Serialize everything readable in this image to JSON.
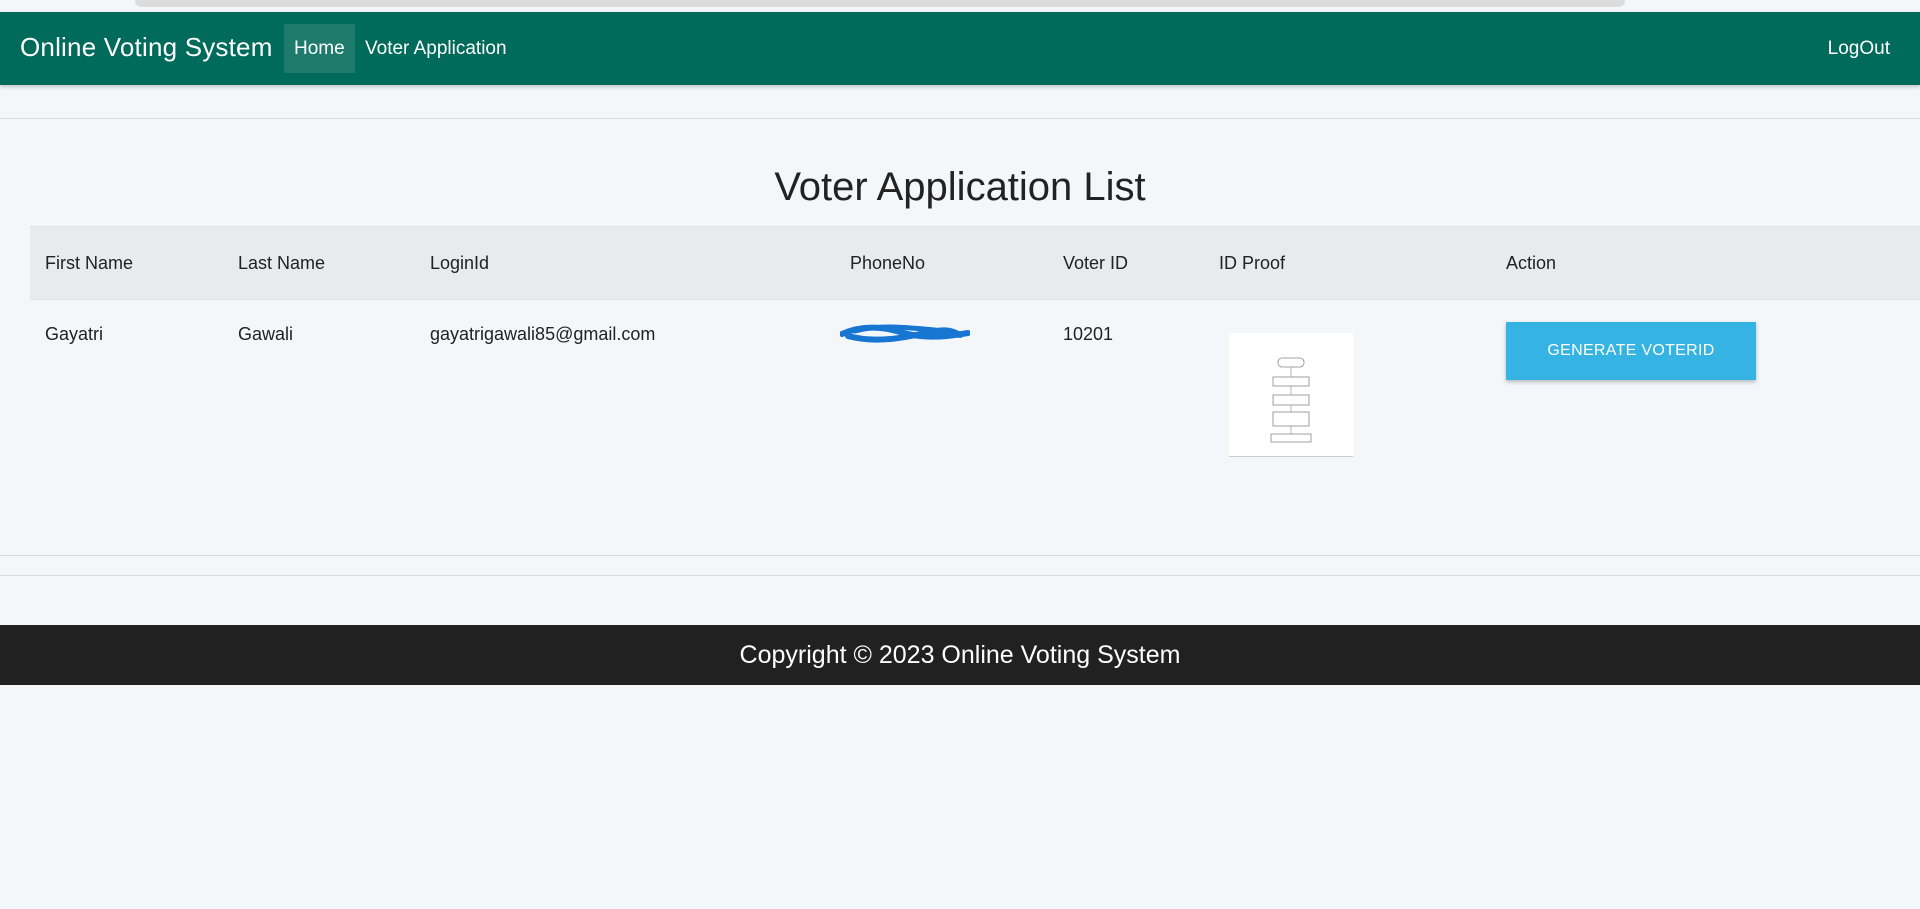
{
  "browser": {
    "tab_bar": ""
  },
  "navbar": {
    "brand": "Online Voting System",
    "items": [
      {
        "label": "Home"
      },
      {
        "label": "Voter Application"
      }
    ],
    "logout_label": "LogOut",
    "color": "#006b5b"
  },
  "main": {
    "title": "Voter Application List",
    "table": {
      "headers": [
        "First Name",
        "Last Name",
        "LoginId",
        "PhoneNo",
        "Voter ID",
        "ID Proof",
        "Action"
      ],
      "rows": [
        {
          "first_name": "Gayatri",
          "last_name": "Gawali",
          "login_id": "gayatrigawali85@gmail.com",
          "phone_no": "",
          "voter_id": "10201",
          "id_proof_icon": "id-proof-thumbnail",
          "action_label": "GENERATE VOTERID"
        }
      ]
    },
    "accent_color": "#35b4e4"
  },
  "footer": {
    "text": "Copyright © 2023 Online Voting System"
  }
}
